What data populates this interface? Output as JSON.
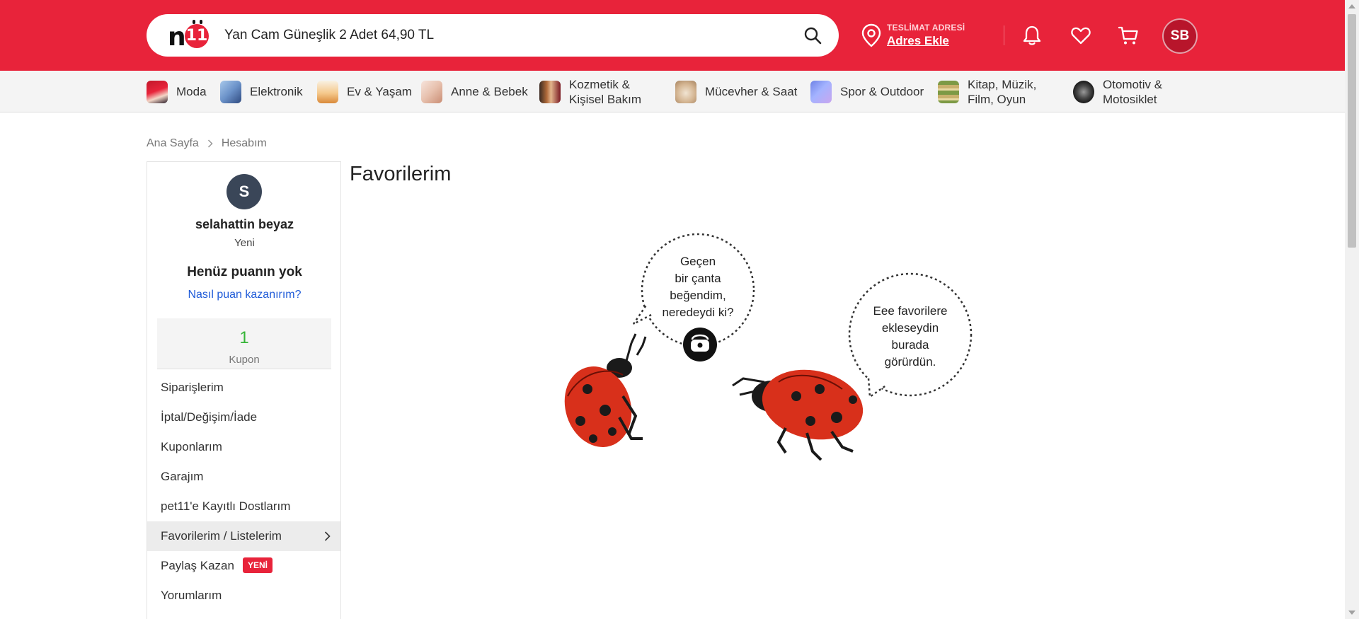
{
  "header": {
    "logo_text": "n11",
    "search": {
      "value": "Yan Cam Güneşlik 2 Adet 64,90 TL"
    },
    "delivery": {
      "caption": "TESLİMAT ADRESİ",
      "link": "Adres Ekle"
    },
    "user_initials": "SB",
    "icons": [
      "search-icon",
      "location-pin-icon",
      "bell-icon",
      "heart-icon",
      "cart-icon"
    ],
    "colors": {
      "brand": "#e8233a"
    }
  },
  "categories": [
    {
      "label": "Moda"
    },
    {
      "label": "Elektronik"
    },
    {
      "label": "Ev & Yaşam"
    },
    {
      "label": "Anne & Bebek"
    },
    {
      "label": "Kozmetik & Kişisel Bakım"
    },
    {
      "label": "Mücevher & Saat"
    },
    {
      "label": "Spor & Outdoor"
    },
    {
      "label": "Kitap, Müzik, Film, Oyun"
    },
    {
      "label": "Otomotiv & Motosiklet"
    }
  ],
  "breadcrumb": {
    "home": "Ana Sayfa",
    "current": "Hesabım"
  },
  "sidebar": {
    "avatar_letter": "S",
    "name": "selahattin beyaz",
    "level": "Yeni",
    "points": "Henüz puanın yok",
    "howto": "Nasıl puan kazanırım?",
    "coupon": {
      "count": "1",
      "label": "Kupon"
    },
    "menu": [
      {
        "label": "Siparişlerim"
      },
      {
        "label": "İptal/Değişim/İade"
      },
      {
        "label": "Kuponlarım"
      },
      {
        "label": "Garajım"
      },
      {
        "label": "pet11'e Kayıtlı Dostlarım"
      },
      {
        "label": "Favorilerim / Listelerim"
      },
      {
        "label": "Paylaş Kazan",
        "badge": "YENİ"
      },
      {
        "label": "Yorumlarım"
      }
    ]
  },
  "main": {
    "title": "Favorilerim",
    "bubble_left": [
      "Geçen",
      "bir çanta",
      "beğendim,",
      "neredeydi ki?"
    ],
    "bubble_right": [
      "Eee favorilere",
      "ekleseydin",
      "burada",
      "görürdün."
    ]
  }
}
